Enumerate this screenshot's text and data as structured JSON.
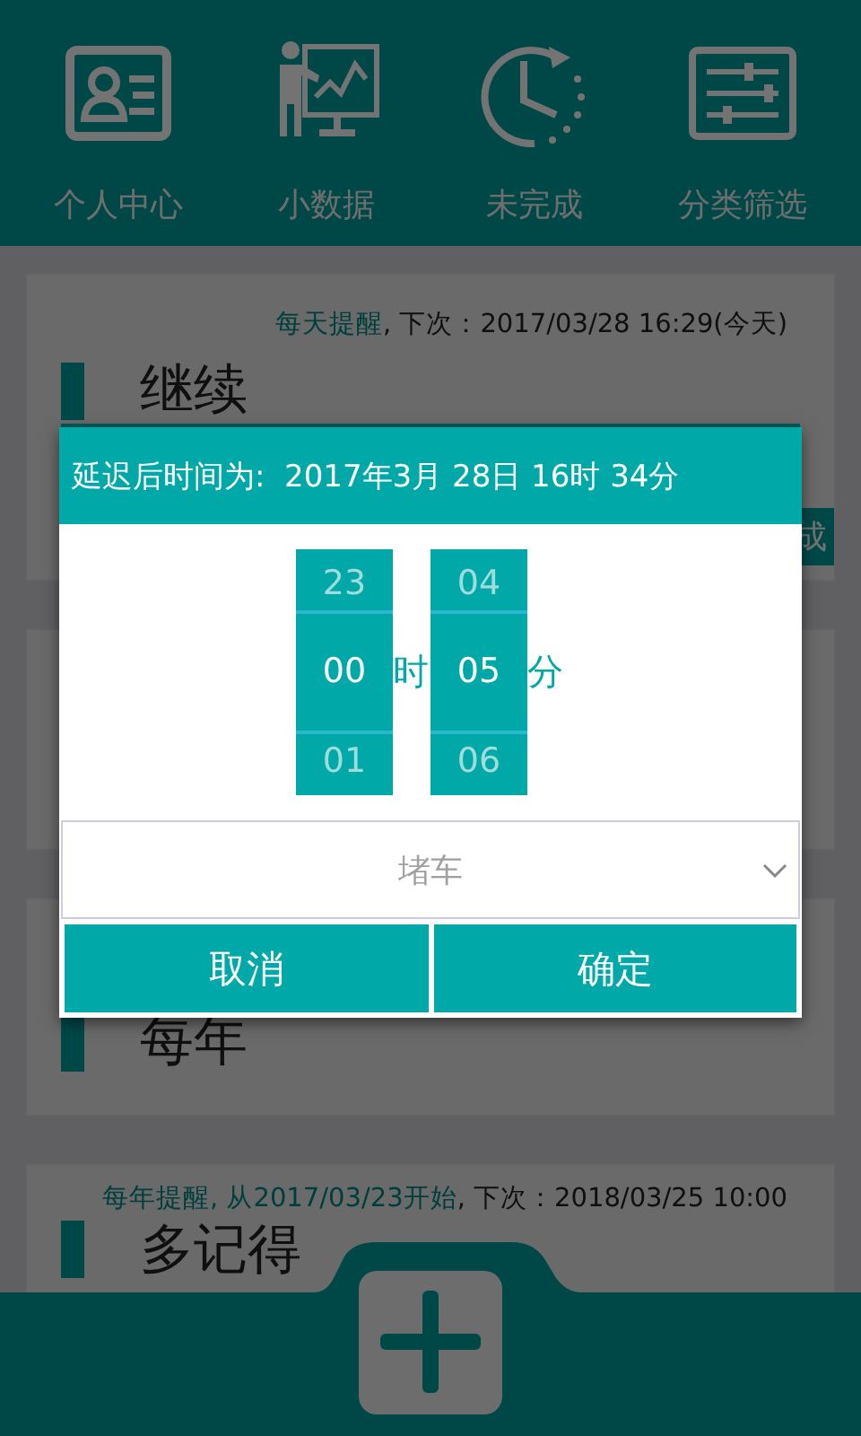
{
  "nav_tabs": [
    {
      "label": "个人中心"
    },
    {
      "label": "小数据"
    },
    {
      "label": "未完成"
    },
    {
      "label": "分类筛选"
    }
  ],
  "cards": [
    {
      "repeat": "每天提醒",
      "next": ", 下次：2017/03/28 16:29(今天)",
      "title": "继续",
      "action": "成"
    },
    {
      "kind": "covered"
    },
    {
      "title": "每年"
    },
    {
      "repeat": "每年提醒, 从2017/03/23开始",
      "next": ", 下次：2018/03/25 10:00",
      "title": "多记得"
    }
  ],
  "dialog": {
    "title": "延迟后时间为:  2017年3月 28日 16时 34分",
    "pickers": [
      {
        "above": "23",
        "value": "00",
        "below": "01",
        "unit": "时"
      },
      {
        "above": "04",
        "value": "05",
        "below": "06",
        "unit": "分"
      }
    ],
    "reason": {
      "placeholder": "堵车"
    },
    "buttons": [
      "取消",
      "确定"
    ]
  }
}
